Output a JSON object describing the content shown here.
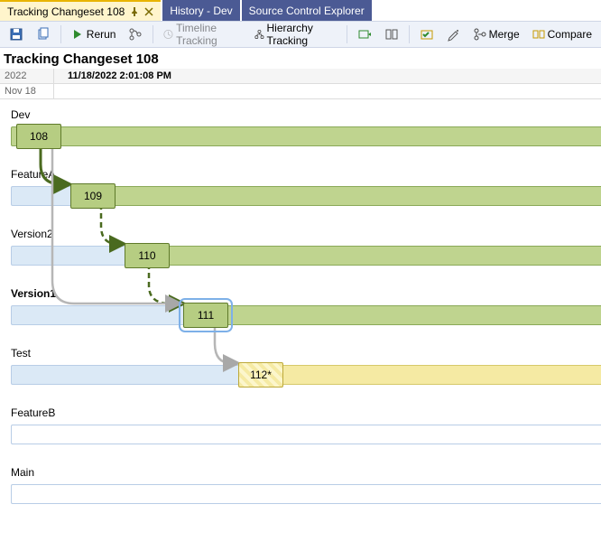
{
  "tabs": {
    "active": "Tracking Changeset 108",
    "bg1": "History - Dev",
    "bg2": "Source Control Explorer"
  },
  "toolbar": {
    "rerun": "Rerun",
    "timeline": "Timeline Tracking",
    "hierarchy": "Hierarchy Tracking",
    "merge": "Merge",
    "compare": "Compare"
  },
  "title": "Tracking Changeset 108",
  "time": {
    "year": "2022",
    "date": "11/18/2022 2:01:08 PM",
    "day": "Nov 18"
  },
  "branches": {
    "dev": "Dev",
    "featureA": "FeatureA",
    "version2": "Version2",
    "version1": "Version1",
    "test": "Test",
    "featureB": "FeatureB",
    "main": "Main"
  },
  "nodes": {
    "n108": "108",
    "n109": "109",
    "n110": "110",
    "n111": "111",
    "n112": "112*"
  },
  "chart_data": {
    "type": "timeline",
    "title": "Tracking Changeset 108",
    "timestamp": "11/18/2022 2:01:08 PM",
    "branches": [
      "Dev",
      "FeatureA",
      "Version2",
      "Version1",
      "Test",
      "FeatureB",
      "Main"
    ],
    "nodes": [
      {
        "branch": "Dev",
        "changeset": 108,
        "x": 0,
        "state": "merged"
      },
      {
        "branch": "FeatureA",
        "changeset": 109,
        "x": 1,
        "state": "merged"
      },
      {
        "branch": "Version2",
        "changeset": 110,
        "x": 2,
        "state": "merged"
      },
      {
        "branch": "Version1",
        "changeset": 111,
        "x": 3,
        "state": "merged",
        "selected": true
      },
      {
        "branch": "Test",
        "changeset": "112*",
        "x": 4,
        "state": "pending"
      }
    ],
    "edges": [
      {
        "from": 108,
        "to": 109,
        "type": "merge"
      },
      {
        "from": 109,
        "to": 110,
        "type": "baseless"
      },
      {
        "from": 110,
        "to": 111,
        "type": "baseless"
      },
      {
        "from": 108,
        "to": 111,
        "type": "relation"
      },
      {
        "from": 111,
        "to": "112*",
        "type": "relation"
      }
    ]
  }
}
